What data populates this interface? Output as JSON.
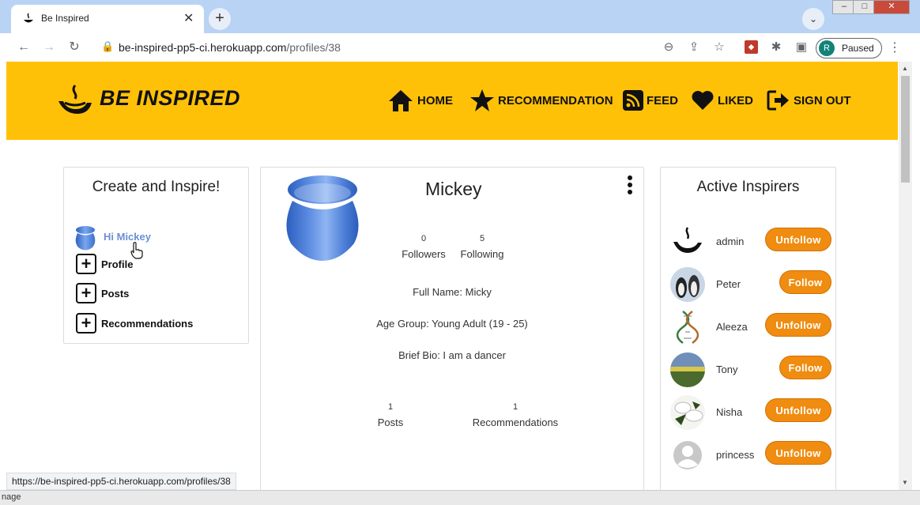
{
  "browser": {
    "tab_title": "Be Inspired",
    "url_host": "be-inspired-pp5-ci.herokuapp.com",
    "url_path": "/profiles/38",
    "profile_initial": "R",
    "profile_status": "Paused",
    "status_bar_url": "https://be-inspired-pp5-ci.herokuapp.com/profiles/38",
    "bottom_fragment": "nage"
  },
  "navbar": {
    "brand": "BE INSPIRED",
    "links": [
      {
        "label": "HOME",
        "icon": "home-icon"
      },
      {
        "label": "RECOMMENDATION",
        "icon": "star-icon"
      },
      {
        "label": "FEED",
        "icon": "rss-icon"
      },
      {
        "label": "LIKED",
        "icon": "heart-icon"
      },
      {
        "label": "SIGN OUT",
        "icon": "sign-out-icon"
      }
    ],
    "bg_color": "#ffc107"
  },
  "left_panel": {
    "title": "Create and Inspire!",
    "greeting": "Hi Mickey",
    "items": [
      "Profile",
      "Posts",
      "Recommendations"
    ]
  },
  "profile": {
    "name": "Mickey",
    "followers_count": "0",
    "followers_label": "Followers",
    "following_count": "5",
    "following_label": "Following",
    "full_name": "Full Name: Micky",
    "age_group": "Age Group: Young Adult (19 - 25)",
    "bio": "Brief Bio: I am a dancer",
    "posts_count": "1",
    "posts_label": "Posts",
    "recommendations_count": "1",
    "recommendations_label": "Recommendations"
  },
  "right_panel": {
    "title": "Active Inspirers",
    "inspirers": [
      {
        "name": "admin",
        "action": "Unfollow"
      },
      {
        "name": "Peter",
        "action": "Follow"
      },
      {
        "name": "Aleeza",
        "action": "Unfollow"
      },
      {
        "name": "Tony",
        "action": "Follow"
      },
      {
        "name": "Nisha",
        "action": "Unfollow"
      },
      {
        "name": "princess",
        "action": "Unfollow"
      }
    ],
    "button_color": "#f08c10"
  }
}
